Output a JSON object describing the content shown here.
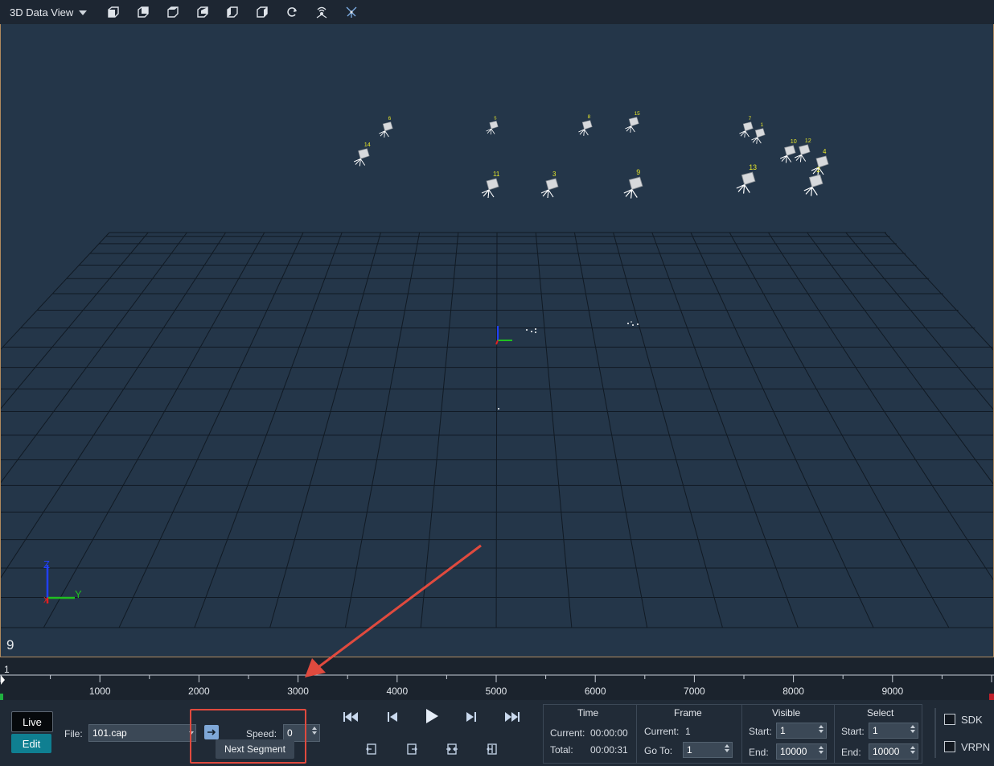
{
  "toolbar": {
    "view_title": "3D Data View",
    "icons": [
      "view-front-icon",
      "view-back-icon",
      "view-top-icon",
      "view-bottom-icon",
      "view-left-icon",
      "view-right-icon",
      "reset-view-icon",
      "camera-mode-icon",
      "tracking-mode-icon"
    ]
  },
  "viewport": {
    "frame_number": "9",
    "axis_labels": {
      "z": "Z",
      "y": "Y",
      "x": "X"
    },
    "cameras": [
      {
        "id": "6"
      },
      {
        "id": "14"
      },
      {
        "id": "5"
      },
      {
        "id": "8"
      },
      {
        "id": "15"
      },
      {
        "id": "7"
      },
      {
        "id": "1"
      },
      {
        "id": "10"
      },
      {
        "id": "12"
      },
      {
        "id": "4"
      },
      {
        "id": "11"
      },
      {
        "id": "3"
      },
      {
        "id": "9"
      },
      {
        "id": "13"
      },
      {
        "id": "2"
      }
    ],
    "colors": {
      "background": "#243649",
      "grid": "#111a24",
      "camera_label": "#e8e82a"
    }
  },
  "timeline": {
    "start_label": "1",
    "ticks": [
      "1000",
      "2000",
      "3000",
      "4000",
      "5000",
      "6000",
      "7000",
      "8000",
      "9000"
    ]
  },
  "controls": {
    "live_label": "Live",
    "edit_label": "Edit",
    "file_label": "File:",
    "file_value": "101.cap",
    "speed_label": "Speed:",
    "speed_value": "0",
    "tooltip": "Next Segment"
  },
  "time_panel": {
    "title": "Time",
    "current_label": "Current:",
    "current_value": "00:00:00",
    "total_label": "Total:",
    "total_value": "00:00:31"
  },
  "frame_panel": {
    "title": "Frame",
    "current_label": "Current:",
    "current_value": "1",
    "goto_label": "Go To:",
    "goto_value": "1"
  },
  "visible_panel": {
    "title": "Visible",
    "start_label": "Start:",
    "start_value": "1",
    "end_label": "End:",
    "end_value": "10000"
  },
  "select_panel": {
    "title": "Select",
    "start_label": "Start:",
    "start_value": "1",
    "end_label": "End:",
    "end_value": "10000"
  },
  "outputs": {
    "sdk_label": "SDK",
    "vrpn_label": "VRPN"
  },
  "annotation_color": "#e04a3e"
}
